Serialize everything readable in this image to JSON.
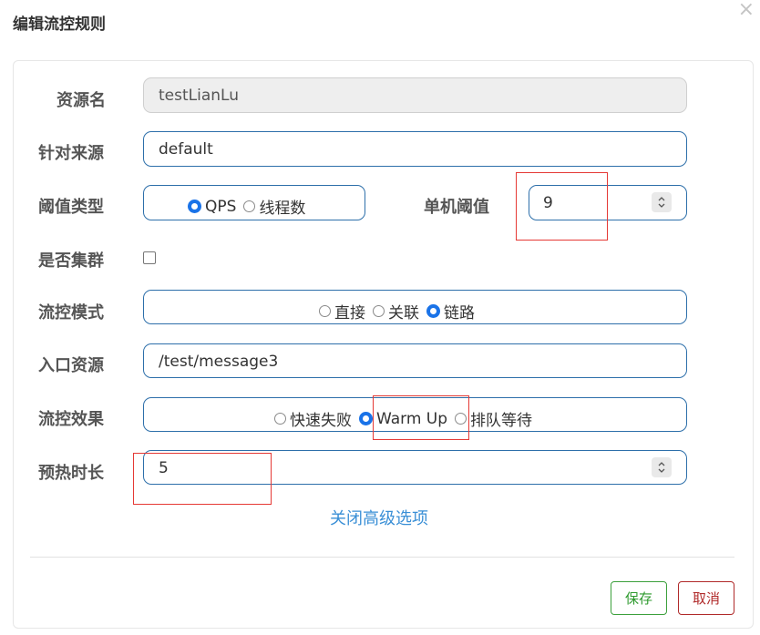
{
  "dialog": {
    "title": "编辑流控规则",
    "close_glyph": "×"
  },
  "form": {
    "resource_name": {
      "label": "资源名",
      "value": "testLianLu"
    },
    "limit_app": {
      "label": "针对来源",
      "value": "default"
    },
    "threshold_type": {
      "label": "阈值类型",
      "options": [
        "QPS",
        "线程数"
      ],
      "selected": "QPS"
    },
    "threshold_value": {
      "label": "单机阈值",
      "value": "9"
    },
    "cluster_mode": {
      "label": "是否集群",
      "checked": false
    },
    "strategy": {
      "label": "流控模式",
      "options": [
        "直接",
        "关联",
        "链路"
      ],
      "selected": "链路"
    },
    "entry_resource": {
      "label": "入口资源",
      "value": "/test/message3"
    },
    "control_behavior": {
      "label": "流控效果",
      "options": [
        "快速失败",
        "Warm Up",
        "排队等待"
      ],
      "selected": "Warm Up"
    },
    "warmup_period": {
      "label": "预热时长",
      "value": "5"
    }
  },
  "advanced_link": "关闭高级选项",
  "buttons": {
    "save": "保存",
    "cancel": "取消"
  },
  "colors": {
    "accent": "#1a73e8",
    "border": "#2d6faa",
    "save": "#3ca03c",
    "cancel": "#b02a2a",
    "highlight": "#e53935",
    "link": "#3a8fd6"
  }
}
